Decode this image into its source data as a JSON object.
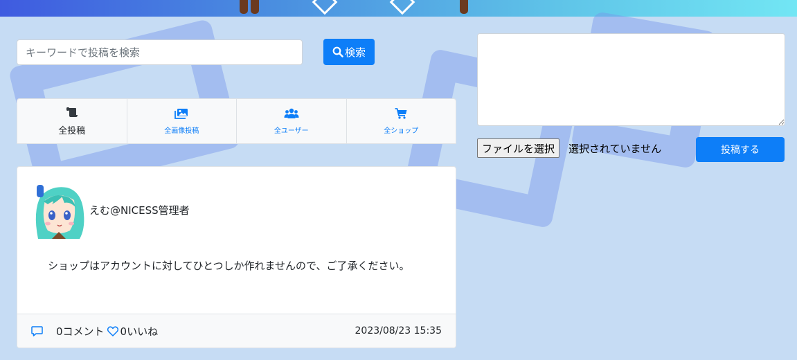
{
  "search": {
    "placeholder": "キーワードで投稿を検索",
    "value": "",
    "button_label": "検索"
  },
  "tabs": [
    {
      "label": "全投稿",
      "icon": "scroll-icon",
      "active": true
    },
    {
      "label": "全画像投稿",
      "icon": "images-icon",
      "active": false
    },
    {
      "label": "全ユーザー",
      "icon": "users-icon",
      "active": false
    },
    {
      "label": "全ショップ",
      "icon": "cart-icon",
      "active": false
    }
  ],
  "post": {
    "author": "えむ@NICESS管理者",
    "body": "ショップはアカウントに対してひとつしか作れませんので、ご了承ください。",
    "comment_count": "0コメント",
    "like_count": "0いいね",
    "timestamp": "2023/08/23 15:35"
  },
  "compose": {
    "textarea_value": "",
    "file_button_label": "ファイルを選択",
    "file_status": "選択されていません",
    "post_button_label": "投稿する"
  },
  "colors": {
    "primary": "#0d7ef8",
    "background": "#c6dcf4"
  }
}
